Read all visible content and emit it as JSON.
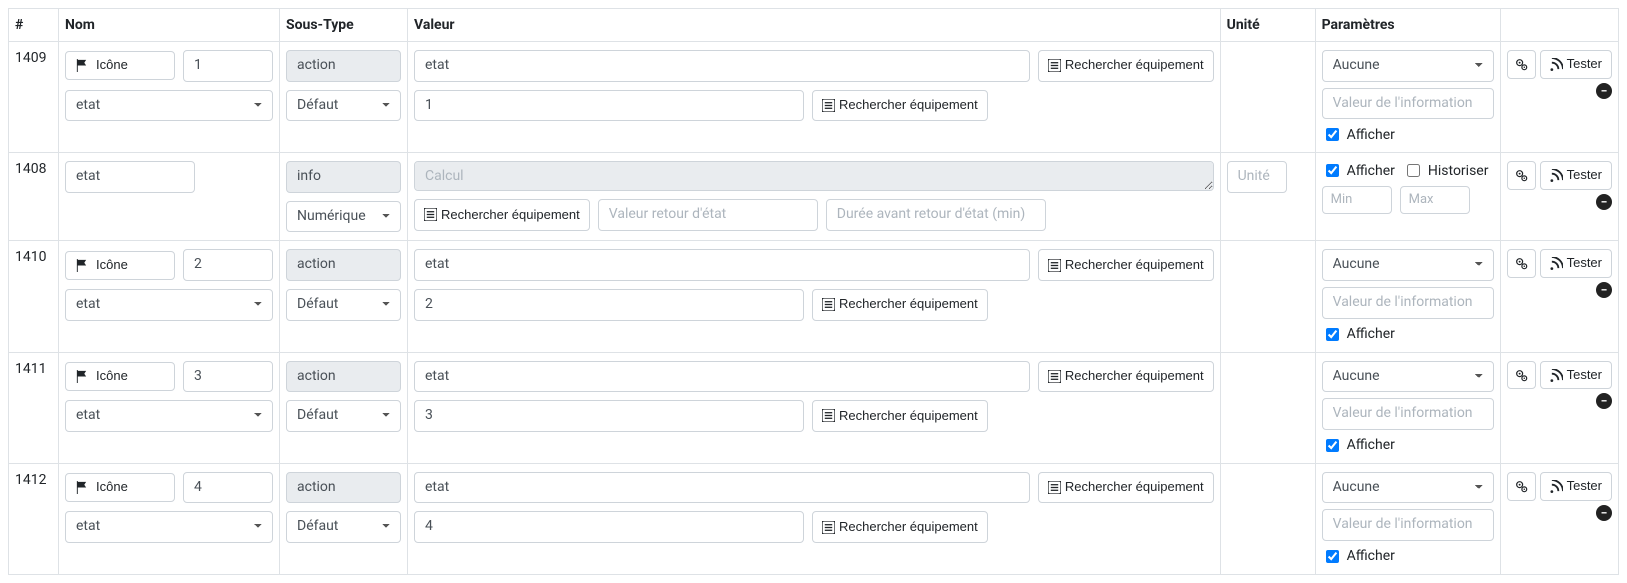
{
  "headers": {
    "id": "#",
    "nom": "Nom",
    "sous_type": "Sous-Type",
    "valeur": "Valeur",
    "unite": "Unité",
    "parametres": "Paramètres",
    "actions": ""
  },
  "labels": {
    "icone_btn": "Icône",
    "rechercher_eq": "Rechercher équipement",
    "afficher": "Afficher",
    "historiser": "Historiser",
    "tester": "Tester",
    "aucune_option": "Aucune",
    "defaut_option": "Défaut",
    "numerique_option": "Numérique"
  },
  "placeholders": {
    "valeur_info": "Valeur de l'information",
    "calcul": "Calcul",
    "valeur_retour": "Valeur retour d'état",
    "duree_retour": "Durée avant retour d'état (min)",
    "unite": "Unité",
    "min": "Min",
    "max": "Max"
  },
  "rows": [
    {
      "id": "1409",
      "type": "action",
      "nom_num": "1",
      "nom_sel": "etat",
      "sous_type_top": "action",
      "sous_type_sel": "Défaut",
      "valeur_top": "etat",
      "valeur_bottom": "1",
      "unite": "",
      "param_sel": "Aucune",
      "param_info": "",
      "afficher": true
    },
    {
      "id": "1408",
      "type": "info",
      "nom_text": "etat",
      "sous_type_top": "info",
      "sous_type_sel": "Numérique",
      "calcul": "",
      "valeur_retour": "",
      "duree_retour": "",
      "unite": "",
      "min": "",
      "max": "",
      "afficher": true,
      "historiser": false
    },
    {
      "id": "1410",
      "type": "action",
      "nom_num": "2",
      "nom_sel": "etat",
      "sous_type_top": "action",
      "sous_type_sel": "Défaut",
      "valeur_top": "etat",
      "valeur_bottom": "2",
      "unite": "",
      "param_sel": "Aucune",
      "param_info": "",
      "afficher": true
    },
    {
      "id": "1411",
      "type": "action",
      "nom_num": "3",
      "nom_sel": "etat",
      "sous_type_top": "action",
      "sous_type_sel": "Défaut",
      "valeur_top": "etat",
      "valeur_bottom": "3",
      "unite": "",
      "param_sel": "Aucune",
      "param_info": "",
      "afficher": true
    },
    {
      "id": "1412",
      "type": "action",
      "nom_num": "4",
      "nom_sel": "etat",
      "sous_type_top": "action",
      "sous_type_sel": "Défaut",
      "valeur_top": "etat",
      "valeur_bottom": "4",
      "unite": "",
      "param_sel": "Aucune",
      "param_info": "",
      "afficher": true
    }
  ]
}
